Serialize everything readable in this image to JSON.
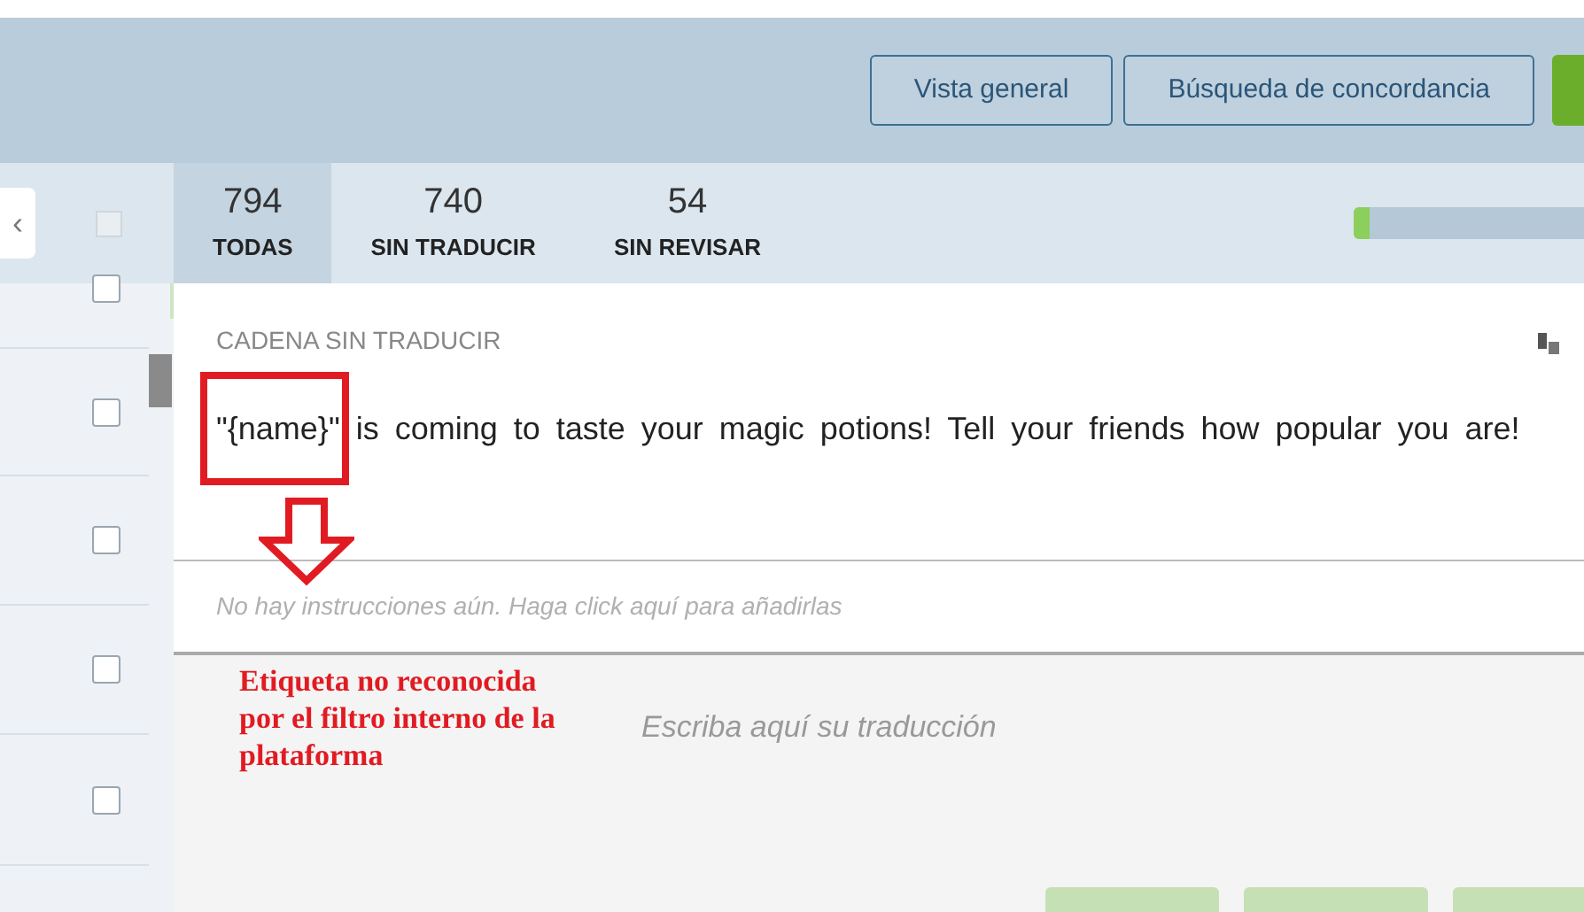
{
  "header": {
    "buttons": [
      {
        "label": "Vista general",
        "kind": "outline"
      },
      {
        "label": "Búsqueda de concordancia",
        "kind": "outline"
      },
      {
        "kind": "primary"
      }
    ]
  },
  "select_all": {
    "checked": false
  },
  "collapse_button": {
    "label": "‹"
  },
  "filter_tabs": [
    {
      "count": "794",
      "label": "TODAS",
      "selected": true
    },
    {
      "count": "740",
      "label": "SIN TRADUCIR",
      "selected": false
    },
    {
      "count": "54",
      "label": "SIN REVISAR",
      "selected": false
    }
  ],
  "progress": {
    "level": 0.07
  },
  "string_list": {
    "rows": [
      {
        "checked": false
      },
      {
        "checked": false
      },
      {
        "checked": false
      },
      {
        "checked": false
      },
      {
        "checked": false
      }
    ]
  },
  "source": {
    "heading": "CADENA SIN TRADUCIR",
    "text": "\"{name}\" is coming to taste your magic potions! Tell your friends how popular you are!"
  },
  "instructions": {
    "text": "No hay instrucciones aún. Haga click aquí para añadirlas"
  },
  "translation": {
    "placeholder": "Escriba aquí su traducción"
  },
  "annotation": {
    "text": "Etiqueta no reconocida por el filtro interno de la plataforma"
  }
}
